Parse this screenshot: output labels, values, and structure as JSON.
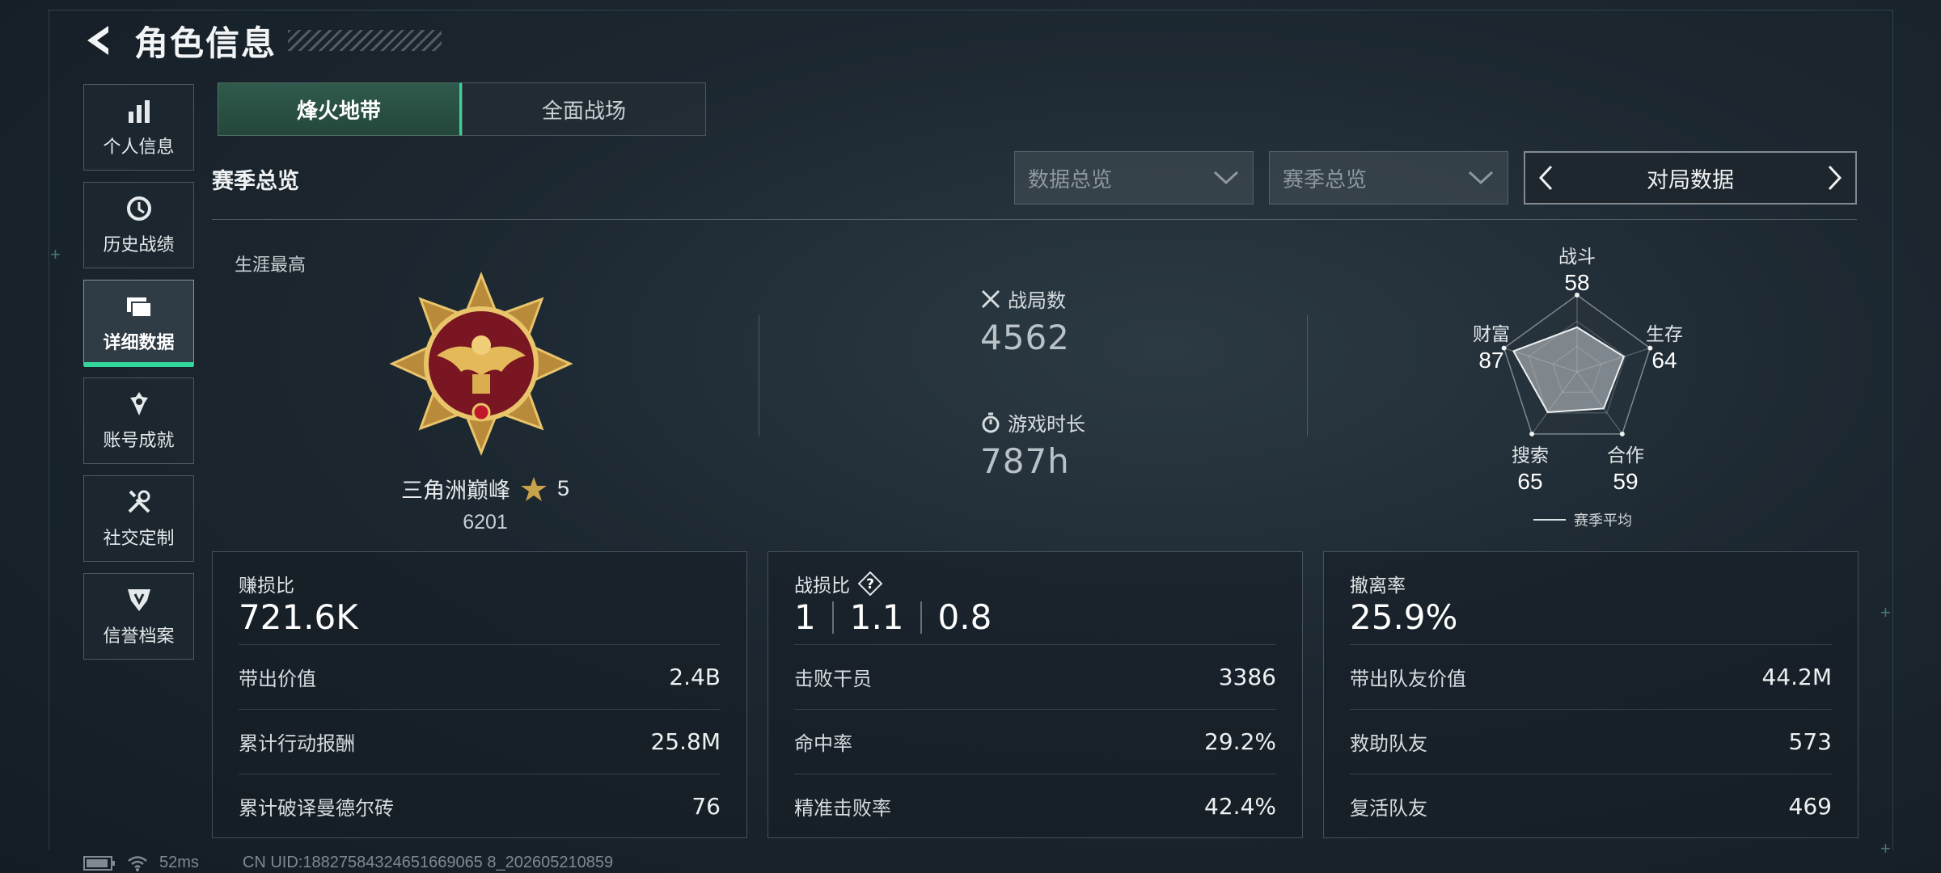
{
  "header": {
    "title": "角色信息"
  },
  "sidebar": {
    "items": [
      {
        "label": "个人信息",
        "icon": "bar-chart-icon",
        "active": false
      },
      {
        "label": "历史战绩",
        "icon": "history-icon",
        "active": false
      },
      {
        "label": "详细数据",
        "icon": "detail-data-icon",
        "active": true
      },
      {
        "label": "账号成就",
        "icon": "achievement-icon",
        "active": false
      },
      {
        "label": "社交定制",
        "icon": "tools-icon",
        "active": false
      },
      {
        "label": "信誉档案",
        "icon": "credit-icon",
        "active": false
      }
    ]
  },
  "tabs": [
    {
      "label": "烽火地带",
      "active": true
    },
    {
      "label": "全面战场",
      "active": false
    }
  ],
  "section_title": "赛季总览",
  "filters": {
    "dropdown1": "数据总览",
    "dropdown2": "赛季总览",
    "pager_label": "对局数据"
  },
  "career": {
    "label": "生涯最高",
    "rank_name": "三角洲巅峰",
    "stars": "5",
    "score": "6201"
  },
  "stats": {
    "matches_label": "战局数",
    "matches_value": "4562",
    "playtime_label": "游戏时长",
    "playtime_value": "787h"
  },
  "radar": {
    "axes": [
      {
        "label": "战斗",
        "value": 58
      },
      {
        "label": "生存",
        "value": 64
      },
      {
        "label": "合作",
        "value": 59
      },
      {
        "label": "搜索",
        "value": 65
      },
      {
        "label": "财富",
        "value": 87
      }
    ],
    "legend": "赛季平均"
  },
  "cards": [
    {
      "title": "赚损比",
      "main": "721.6K",
      "rows": [
        {
          "label": "带出价值",
          "value": "2.4B"
        },
        {
          "label": "累计行动报酬",
          "value": "25.8M"
        },
        {
          "label": "累计破译曼德尔砖",
          "value": "76"
        }
      ]
    },
    {
      "title": "战损比",
      "main_parts": [
        "1",
        "1.1",
        "0.8"
      ],
      "rows": [
        {
          "label": "击败干员",
          "value": "3386"
        },
        {
          "label": "命中率",
          "value": "29.2%"
        },
        {
          "label": "精准击败率",
          "value": "42.4%"
        }
      ]
    },
    {
      "title": "撤离率",
      "main": "25.9%",
      "rows": [
        {
          "label": "带出队友价值",
          "value": "44.2M"
        },
        {
          "label": "救助队友",
          "value": "573"
        },
        {
          "label": "复活队友",
          "value": "469"
        }
      ]
    }
  ],
  "footer": {
    "ping": "52ms",
    "uid": "CN UID:18827584324651669065 8_202605210859"
  },
  "colors": {
    "accent": "#32d69a",
    "background": "#1c2730"
  }
}
